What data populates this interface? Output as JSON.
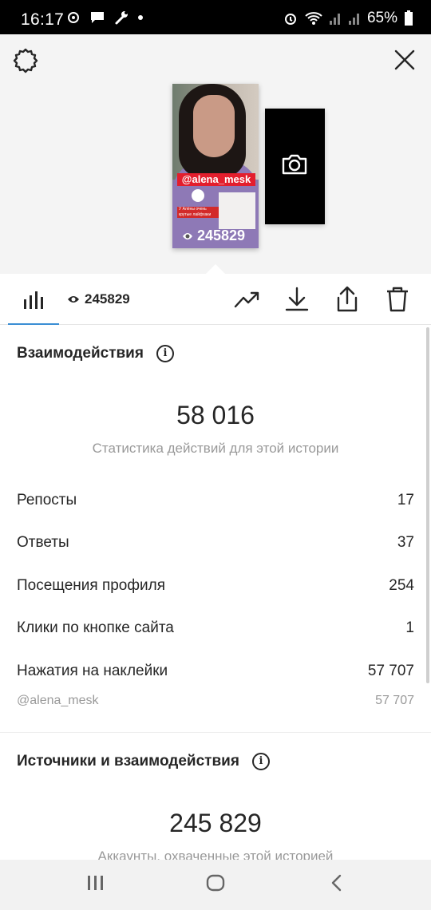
{
  "status_bar": {
    "time": "16:17",
    "battery": "65%"
  },
  "story": {
    "mention": "@alena_mesk",
    "views": "245829",
    "sticker_text": "У Алёны очень крутые лайфхаки"
  },
  "tab": {
    "views": "245829"
  },
  "interactions": {
    "title": "Взаимодействия",
    "total": "58 016",
    "subtitle": "Статистика действий для этой истории",
    "rows": [
      {
        "label": "Репосты",
        "value": "17"
      },
      {
        "label": "Ответы",
        "value": "37"
      },
      {
        "label": "Посещения профиля",
        "value": "254"
      },
      {
        "label": "Клики по кнопке сайта",
        "value": "1"
      },
      {
        "label": "Нажатия на наклейки",
        "value": "57 707"
      }
    ],
    "sub_row": {
      "label": "@alena_mesk",
      "value": "57 707"
    }
  },
  "discovery": {
    "title": "Источники и взаимодействия",
    "total": "245 829",
    "subtitle": "Аккаунты, охваченные этой историей"
  },
  "icons": {
    "info": "i",
    "settings": "gear-icon",
    "close": "close-icon"
  }
}
